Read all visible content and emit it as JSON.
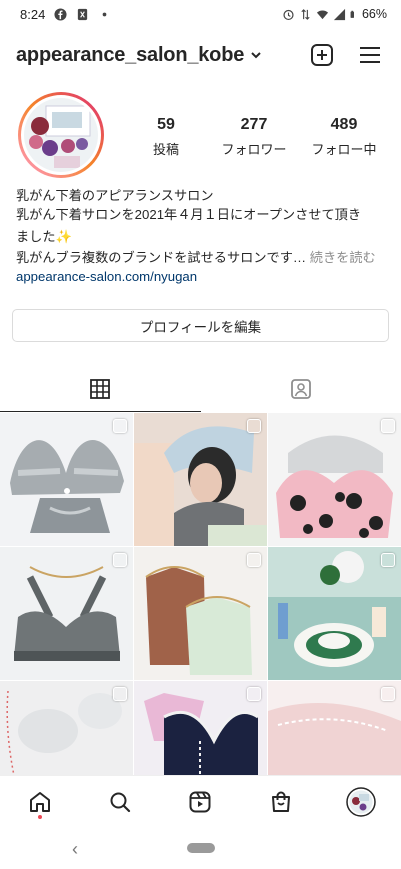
{
  "status_bar": {
    "time": "8:24",
    "battery": "66%",
    "icons": [
      "facebook-icon",
      "notification-icon",
      "dot-icon",
      "alarm-icon",
      "data-icon",
      "wifi-icon",
      "signal-icon",
      "battery-icon"
    ]
  },
  "header": {
    "username": "appearance_salon_kobe",
    "icons": [
      "chevron-down-icon",
      "new-post-icon",
      "menu-icon"
    ]
  },
  "stats": {
    "posts": {
      "value": "59",
      "label": "投稿"
    },
    "followers": {
      "value": "277",
      "label": "フォロワー"
    },
    "following": {
      "value": "489",
      "label": "フォロー中"
    }
  },
  "bio": {
    "line1": "乳がん下着のアピアランスサロン",
    "line2": "乳がん下着サロンを2021年４月１日にオープンさせて頂き",
    "line3": "ました✨",
    "line4": "乳がんブラ複数のブランドを試せるサロンです…",
    "more": " 続きを読む",
    "link": "appearance-salon.com/nyugan"
  },
  "edit_profile_label": "プロフィールを編集",
  "tabs": [
    "grid-icon",
    "tagged-icon"
  ],
  "posts": [
    {
      "name": "post-gray-lace-bra",
      "multi": true
    },
    {
      "name": "post-mannequin-hat",
      "multi": true
    },
    {
      "name": "post-polka-dot-bra",
      "multi": true
    },
    {
      "name": "post-gray-sports-bra",
      "multi": true
    },
    {
      "name": "post-brown-green-tops",
      "multi": true
    },
    {
      "name": "post-table-setting",
      "multi": true
    },
    {
      "name": "post-white-lace",
      "multi": true
    },
    {
      "name": "post-navy-lace-bra",
      "multi": true
    },
    {
      "name": "post-pink-lace",
      "multi": true
    }
  ],
  "bottom_nav": [
    "home-icon",
    "search-icon",
    "reels-icon",
    "shop-icon",
    "profile-avatar"
  ],
  "colors": {
    "text": "#262626",
    "link": "#00376b",
    "muted": "#8e8e8e",
    "notification": "#ed4956"
  }
}
